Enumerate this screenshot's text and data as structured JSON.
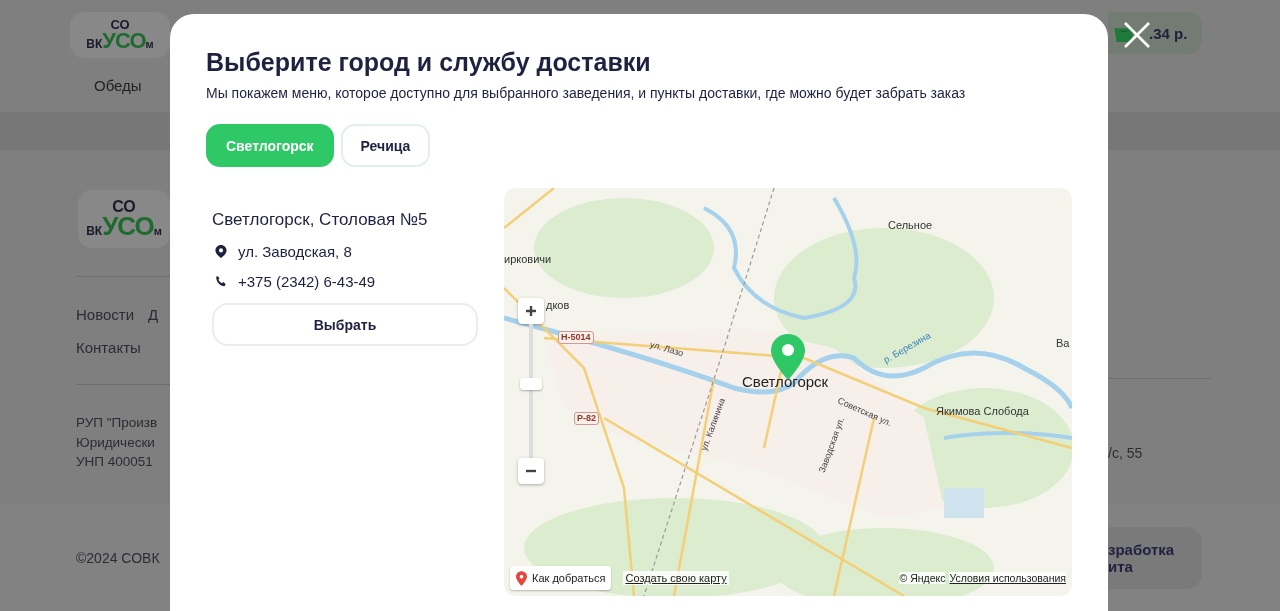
{
  "page": {
    "header": {
      "logo": {
        "top": "СО",
        "left": "ВК",
        "accent": "УСО",
        "right": "м"
      },
      "nav": [
        "Обеды"
      ],
      "cart": {
        "total": ".34 р."
      }
    },
    "footer": {
      "logo": {
        "top": "СО",
        "left": "ВК",
        "accent": "УСО",
        "right": "м"
      },
      "nav": [
        "Новости",
        "Д",
        "Контакты"
      ],
      "company_lines": [
        "РУП \"Произв",
        "Юридически",
        "УНП 400051"
      ],
      "address_tail": "/с, 55",
      "copyright": "©2024 СОВК",
      "developer_lines": [
        "зработка",
        "ита"
      ]
    }
  },
  "modal": {
    "title": "Выберите город и службу доставки",
    "subtitle": "Мы покажем меню, которое доступно для выбранного заведения, и пункты доставки, где можно будет забрать заказ",
    "cities": [
      {
        "label": "Светлогорск",
        "selected": true
      },
      {
        "label": "Речица",
        "selected": false
      }
    ],
    "venue": {
      "name": "Светлогорск, Столовая №5",
      "address": "ул. Заводская, 8",
      "phone": "+375 (2342) 6-43-49",
      "button": "Выбрать"
    },
    "map": {
      "labels": [
        {
          "text": "Сельное",
          "kind": "place"
        },
        {
          "text": "ирковичи",
          "kind": "place"
        },
        {
          "text": "дков",
          "kind": "place"
        },
        {
          "text": "Н-5014",
          "kind": "road"
        },
        {
          "text": "ул. Лазо",
          "kind": "street"
        },
        {
          "text": "Светлогорск",
          "kind": "city"
        },
        {
          "text": "р. Березина",
          "kind": "river"
        },
        {
          "text": "Ва",
          "kind": "place"
        },
        {
          "text": "Якимова Слобода",
          "kind": "place"
        },
        {
          "text": "Р-82",
          "kind": "road"
        },
        {
          "text": "Советская ул.",
          "kind": "street"
        },
        {
          "text": "ул. Калинина",
          "kind": "street"
        },
        {
          "text": "Заводская ул.",
          "kind": "street"
        }
      ],
      "zoom": {
        "level": 0.56
      },
      "route_button": "Как добраться",
      "create_link": "Создать свою карту",
      "copyright": "© Яндекс",
      "terms_link": "Условия использования"
    }
  }
}
